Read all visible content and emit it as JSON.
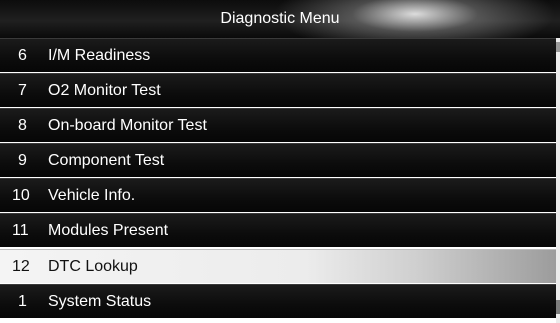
{
  "header": {
    "title": "Diagnostic Menu"
  },
  "menu": {
    "items": [
      {
        "number": "6",
        "label": "I/M Readiness"
      },
      {
        "number": "7",
        "label": "O2 Monitor Test"
      },
      {
        "number": "8",
        "label": "On-board Monitor Test"
      },
      {
        "number": "9",
        "label": "Component Test"
      },
      {
        "number": "10",
        "label": "Vehicle Info."
      },
      {
        "number": "11",
        "label": "Modules Present"
      },
      {
        "number": "12",
        "label": "DTC Lookup",
        "selected": true
      },
      {
        "number": "1",
        "label": "System Status"
      }
    ]
  },
  "colors": {
    "background": "#000000",
    "text": "#ffffff",
    "selected_bg": "#eeeeee",
    "selected_text": "#111111"
  }
}
